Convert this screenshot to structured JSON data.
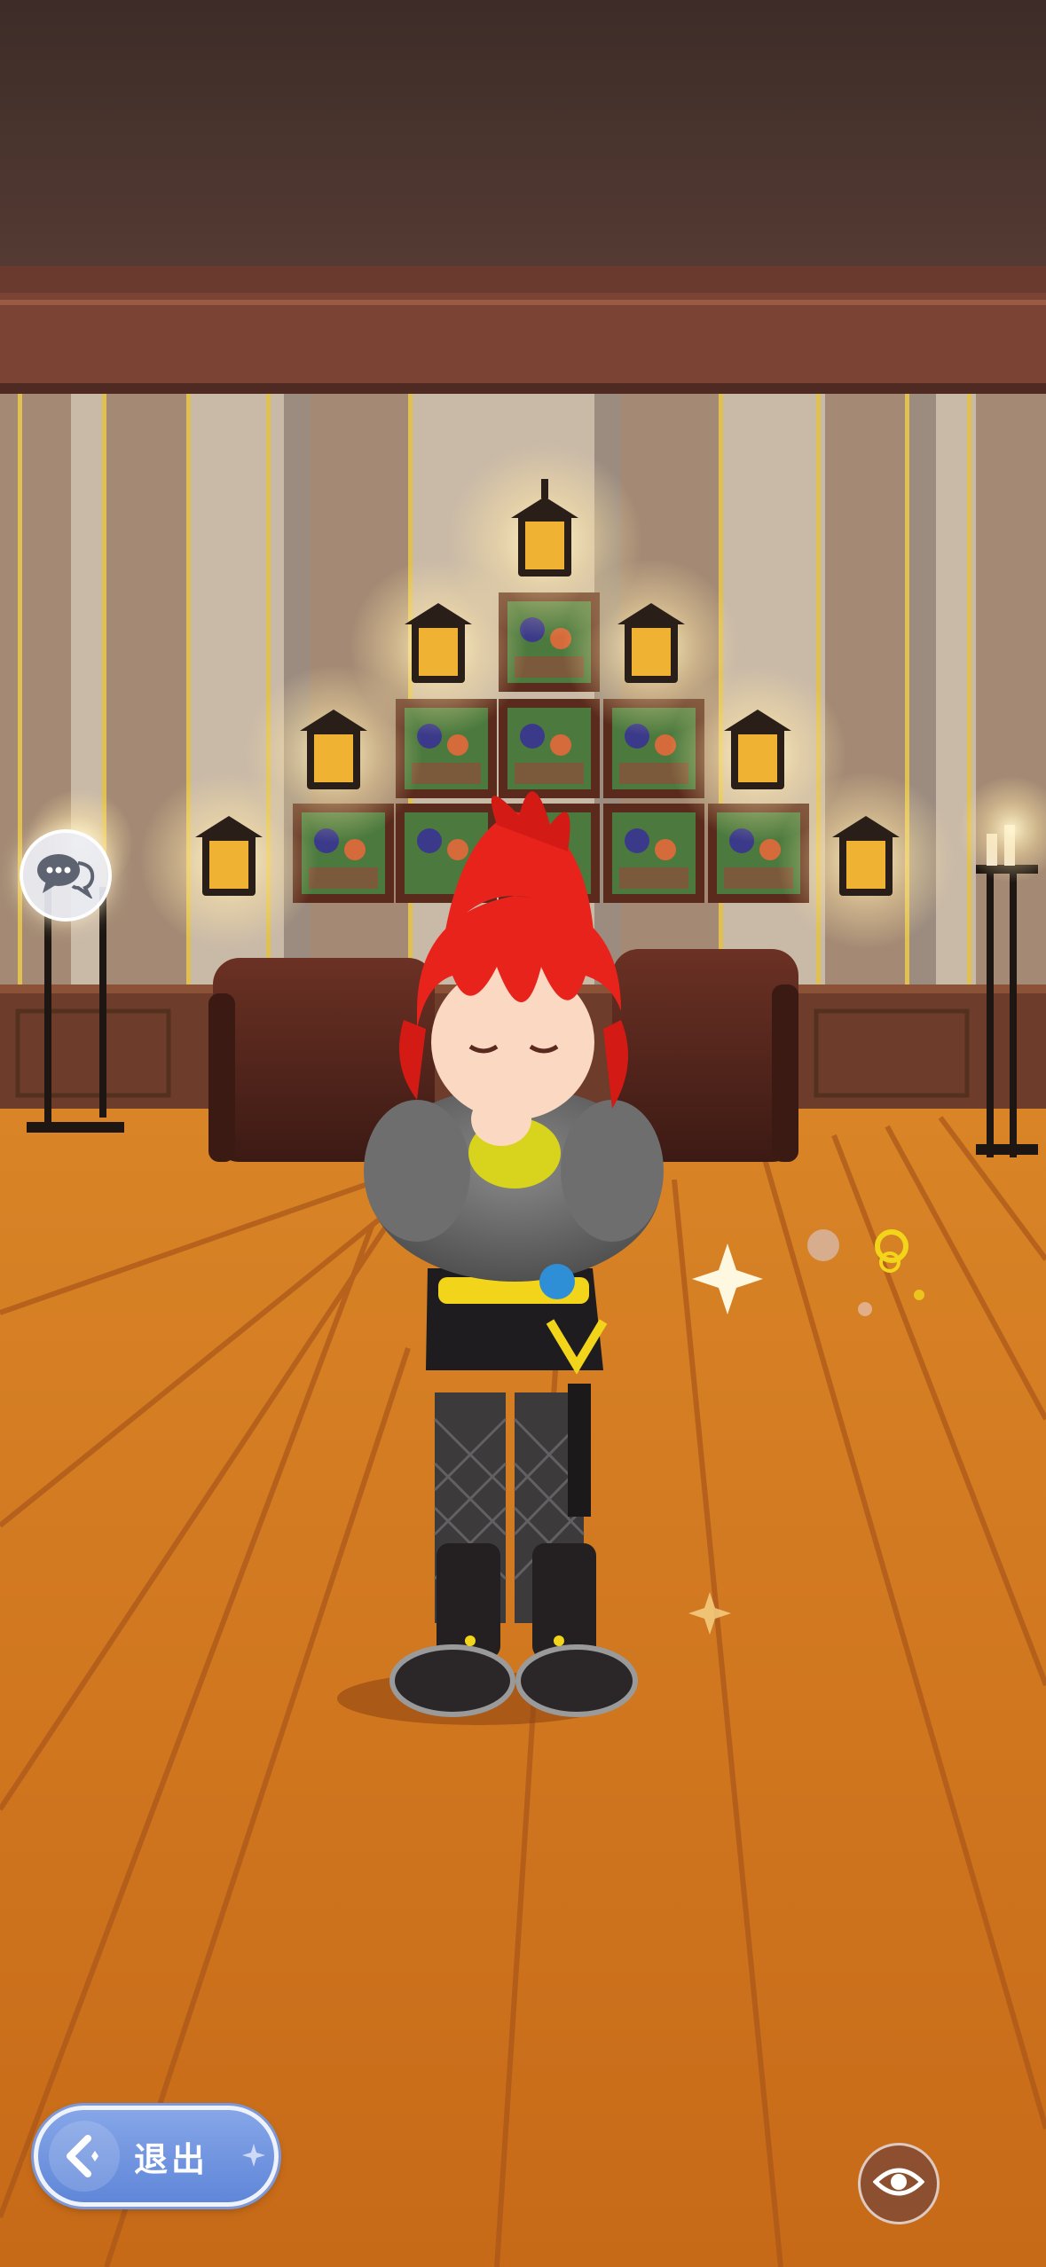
{
  "hud": {
    "exit_label": "退出",
    "chat_icon": "chat-bubbles-icon",
    "view_icon": "eye-icon",
    "back_icon": "back-arrow-icon"
  },
  "colors": {
    "hair": "#e8231c",
    "floor": "#c8701e",
    "exit_button": "#6f92de",
    "accent_yellow": "#f2d51a"
  }
}
